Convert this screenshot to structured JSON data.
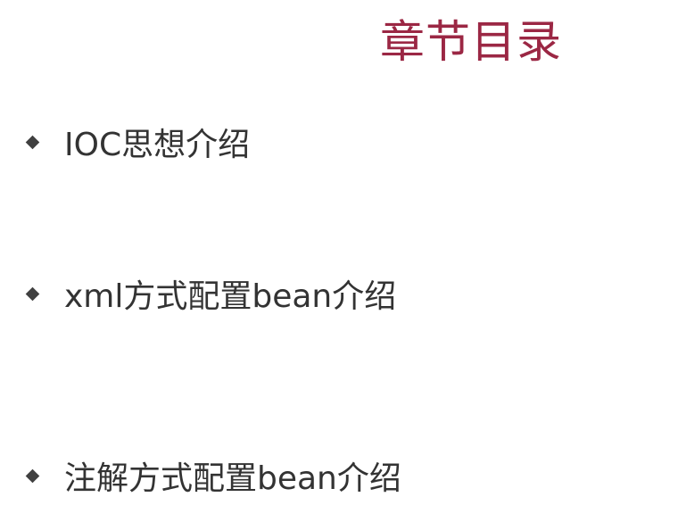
{
  "slide": {
    "title": "章节目录",
    "items": [
      {
        "icon": "diamond-bullet-icon",
        "text": "IOC思想介绍"
      },
      {
        "icon": "diamond-bullet-icon",
        "text": "xml方式配置bean介绍"
      },
      {
        "icon": "diamond-bullet-icon",
        "text": "注解方式配置bean介绍"
      }
    ]
  },
  "colors": {
    "title": "#9b2744",
    "text": "#333333",
    "bullet": "#404040",
    "background": "#ffffff"
  }
}
